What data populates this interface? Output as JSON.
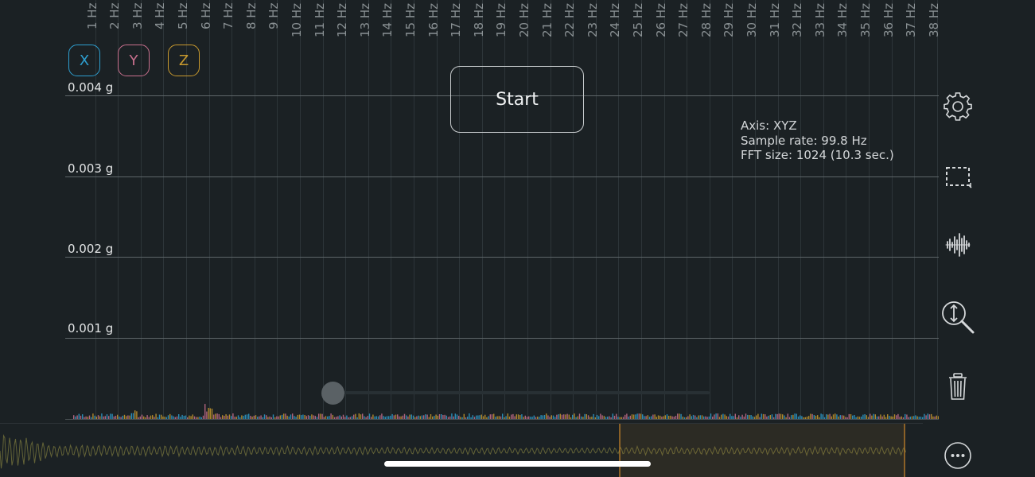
{
  "frequency_axis": {
    "labels": [
      "1 Hz",
      "2 Hz",
      "3 Hz",
      "4 Hz",
      "5 Hz",
      "6 Hz",
      "7 Hz",
      "8 Hz",
      "9 Hz",
      "10 Hz",
      "11 Hz",
      "12 Hz",
      "13 Hz",
      "14 Hz",
      "15 Hz",
      "16 Hz",
      "17 Hz",
      "18 Hz",
      "19 Hz",
      "20 Hz",
      "21 Hz",
      "22 Hz",
      "23 Hz",
      "24 Hz",
      "25 Hz",
      "26 Hz",
      "27 Hz",
      "28 Hz",
      "29 Hz",
      "30 Hz",
      "31 Hz",
      "32 Hz",
      "33 Hz",
      "34 Hz",
      "35 Hz",
      "36 Hz",
      "37 Hz",
      "38 Hz"
    ]
  },
  "amplitude_axis": {
    "labels": [
      "0.004 g",
      "0.003 g",
      "0.002 g",
      "0.001 g"
    ]
  },
  "axis_toggles": [
    {
      "label": "X",
      "color": "#2e9fd0"
    },
    {
      "label": "Y",
      "color": "#c9708e"
    },
    {
      "label": "Z",
      "color": "#c99a2e"
    }
  ],
  "start_button": {
    "label": "Start"
  },
  "info": {
    "axis": "Axis: XYZ",
    "sample_rate": "Sample rate: 99.8 Hz",
    "fft_size": "FFT size: 1024 (10.3 sec.)"
  },
  "slider": {
    "value": 0
  },
  "toolbar": {
    "settings_icon": "gear-icon",
    "select_icon": "selection-rect-icon",
    "waveform_icon": "waveform-icon",
    "zoom_icon": "vertical-zoom-icon",
    "trash_icon": "trash-icon",
    "more_icon": "more-icon"
  },
  "colors": {
    "background": "#1b2124",
    "x_series": "#2e9fd0",
    "y_series": "#c9708e",
    "z_series": "#c99a2e",
    "selection_marker": "#d0892a"
  }
}
